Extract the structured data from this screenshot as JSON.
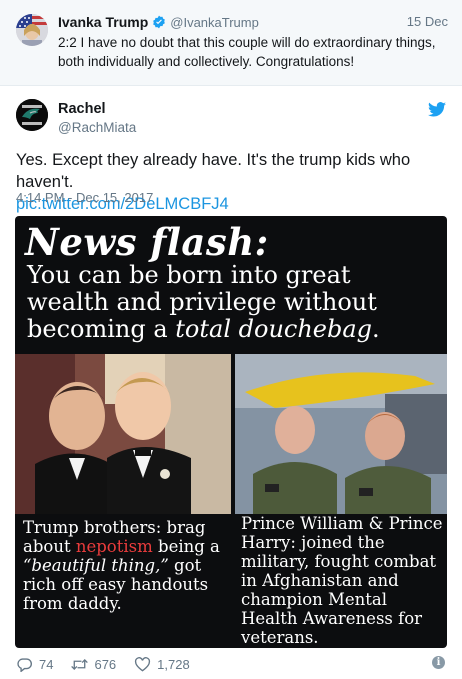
{
  "parent_tweet": {
    "name": "Ivanka Trump",
    "handle": "@IvankaTrump",
    "date": "15 Dec",
    "text": "2:2 I have no doubt that this couple will do extraordinary things, both individually and collectively. Congratulations!"
  },
  "tweet": {
    "name": "Rachel",
    "handle": "@RachMiata",
    "text": "Yes. Except they already have. It's the trump kids who haven't.",
    "link": "pic.twitter.com/2DeLMCBFJ4",
    "timestamp": "4:14 PM - Dec 15, 2017"
  },
  "media": {
    "headline": "News flash:",
    "subhead_1": "You can be born into great wealth and privilege without becoming a ",
    "subhead_em": "total douchebag",
    "subhead_2": ".",
    "caption_left_1": "Trump brothers: brag about ",
    "caption_left_nep": "nepotism",
    "caption_left_2": " being a ",
    "caption_left_em": "“beautiful thing,”",
    "caption_left_3": " got rich off easy handouts from daddy.",
    "caption_right": "Prince William & Prince Harry: joined the military, fought combat in Afghanistan and champion Mental Health Awareness for veterans."
  },
  "actions": {
    "replies": "74",
    "retweets": "676",
    "likes": "1,728"
  },
  "colors": {
    "link": "#1b95e0",
    "verified": "#1da1f2",
    "muted": "#657786",
    "nepotism": "#ea3c3c"
  }
}
